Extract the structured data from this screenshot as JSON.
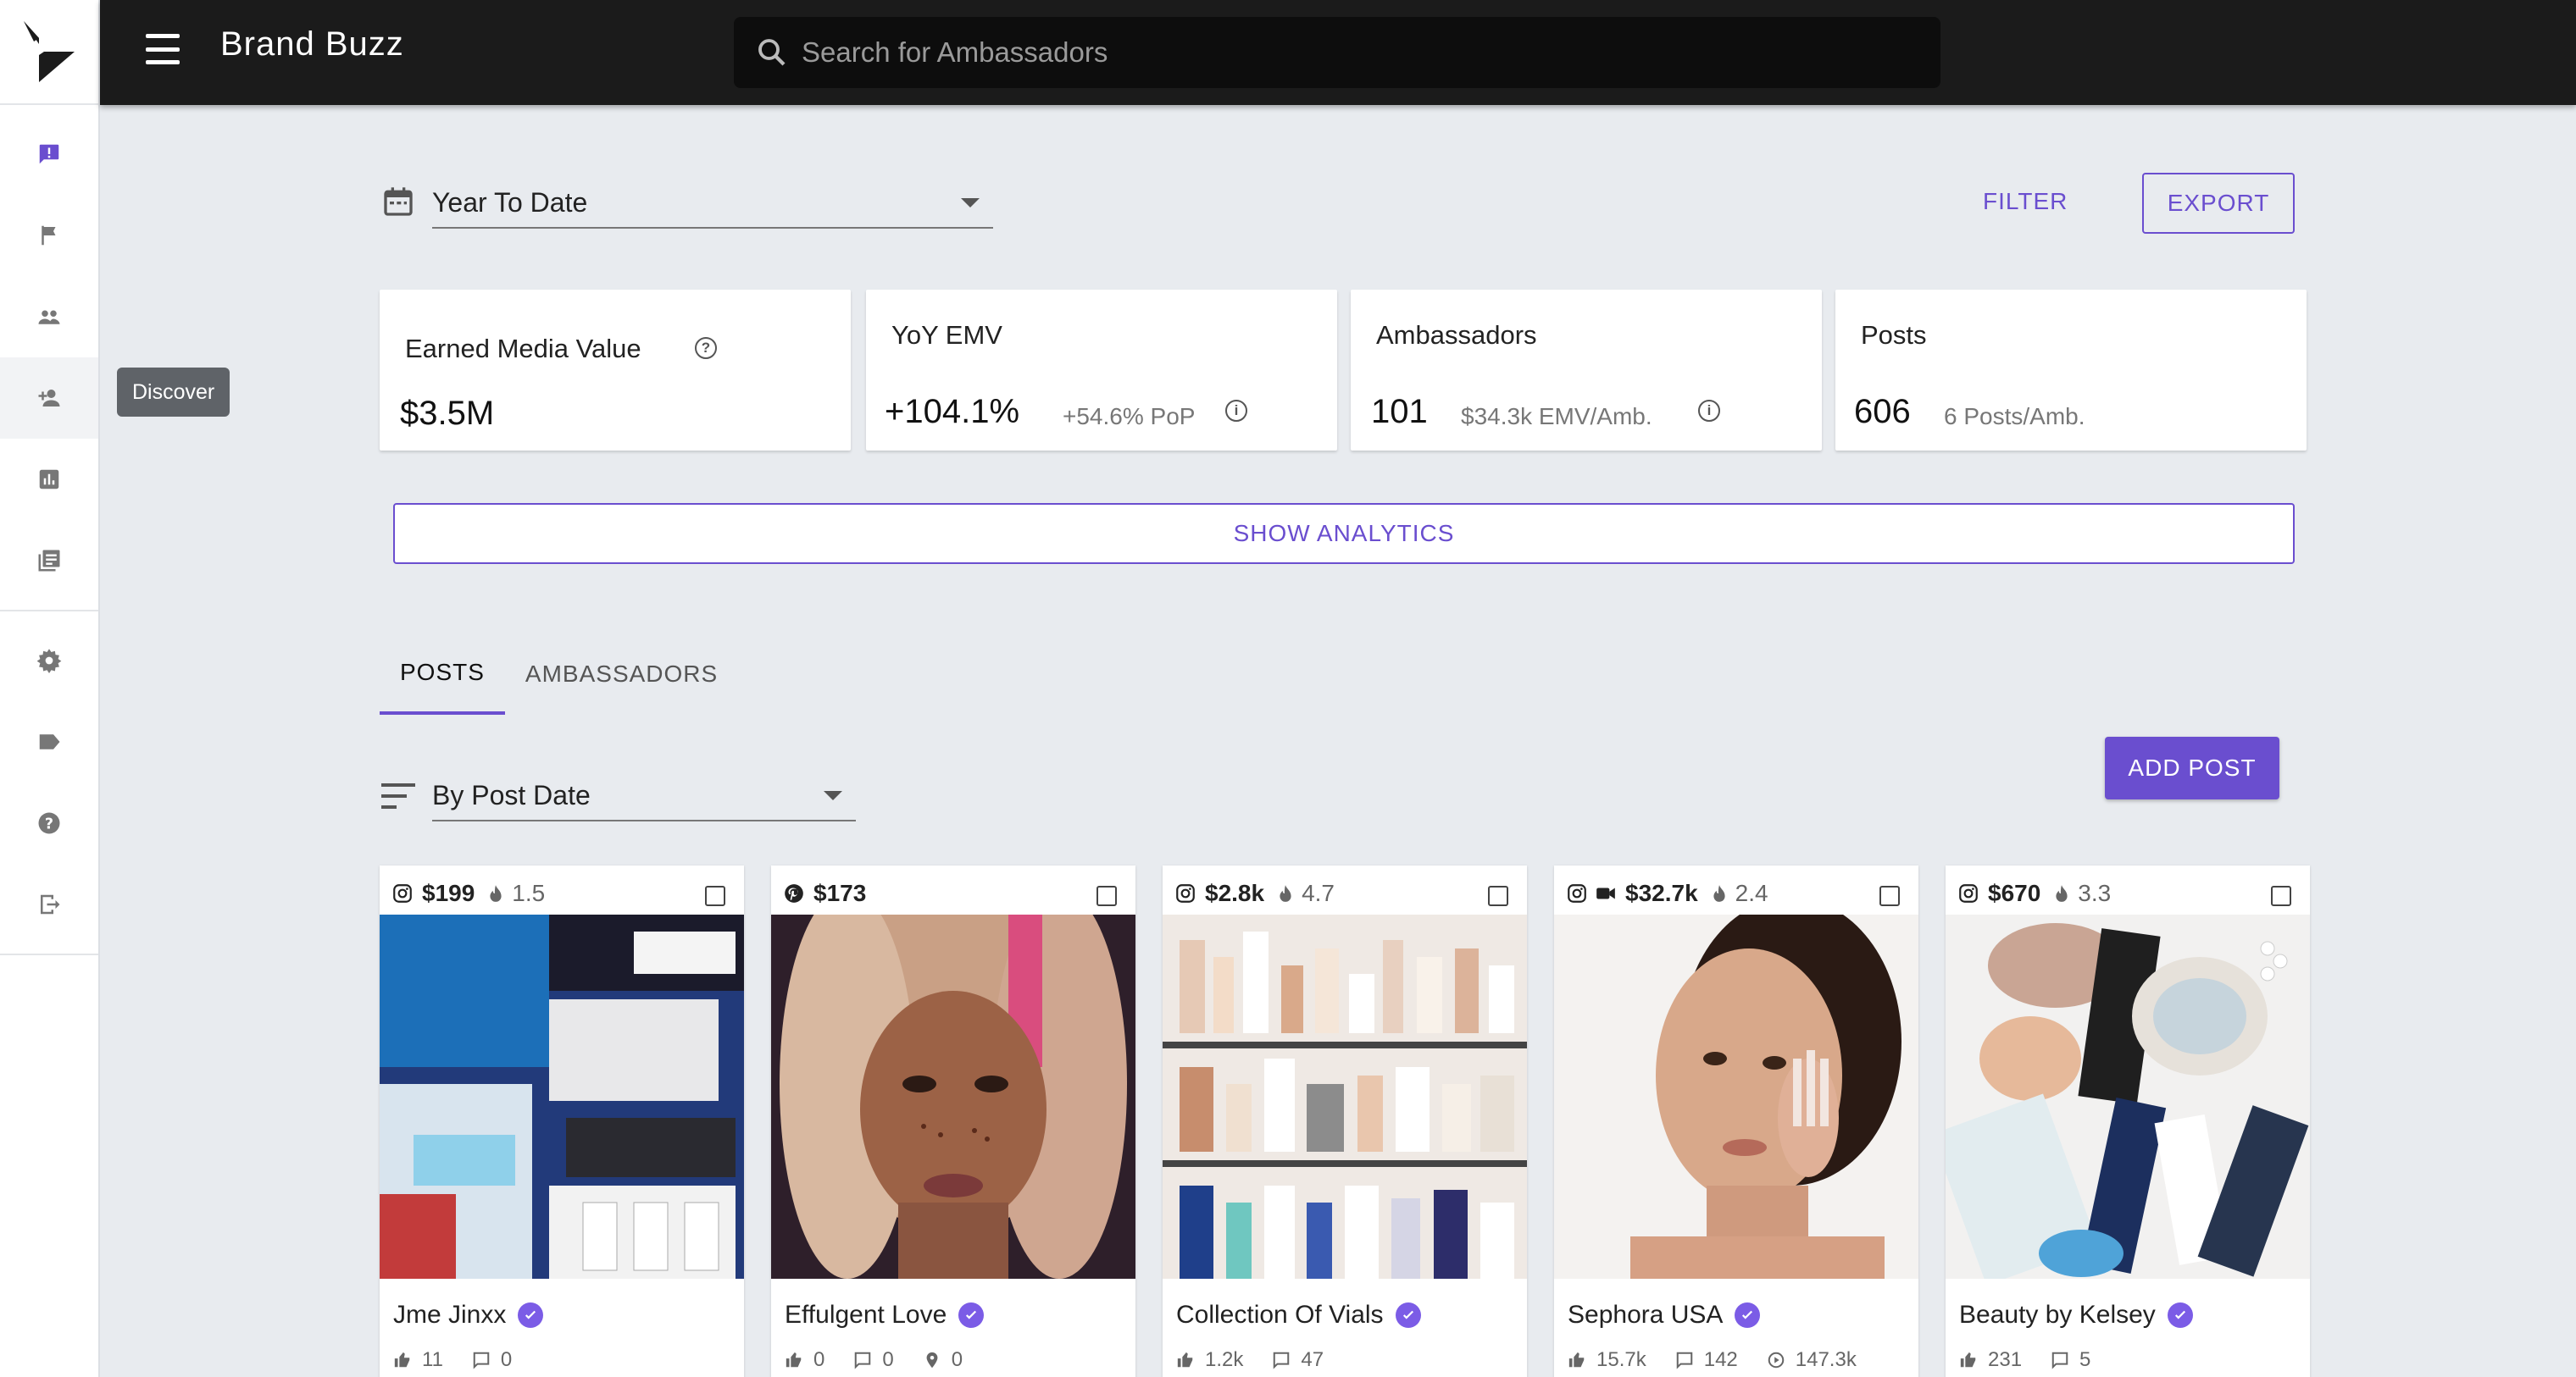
{
  "app": {
    "title": "Brand Buzz"
  },
  "search": {
    "placeholder": "Search for Ambassadors"
  },
  "sidebar": {
    "tooltip": "Discover",
    "items": [
      {
        "icon": "feedback-icon"
      },
      {
        "icon": "flag-icon"
      },
      {
        "icon": "people-icon"
      },
      {
        "icon": "person-add-icon"
      },
      {
        "icon": "analytics-icon"
      },
      {
        "icon": "library-icon"
      },
      {
        "icon": "gear-icon"
      },
      {
        "icon": "tag-icon"
      },
      {
        "icon": "help-icon"
      },
      {
        "icon": "logout-icon"
      }
    ]
  },
  "filters": {
    "date_range": "Year To Date",
    "filter_label": "FILTER",
    "export_label": "EXPORT"
  },
  "kpis": [
    {
      "label": "Earned Media Value",
      "value": "$3.5M",
      "sub": ""
    },
    {
      "label": "YoY EMV",
      "value": "+104.1%",
      "sub": "+54.6% PoP"
    },
    {
      "label": "Ambassadors",
      "value": "101",
      "sub": "$34.3k EMV/Amb."
    },
    {
      "label": "Posts",
      "value": "606",
      "sub": "6 Posts/Amb."
    }
  ],
  "analytics": {
    "label": "SHOW ANALYTICS"
  },
  "tabs": [
    {
      "label": "POSTS",
      "active": true
    },
    {
      "label": "AMBASSADORS",
      "active": false
    }
  ],
  "sort": {
    "value": "By Post Date"
  },
  "add_post": {
    "label": "ADD POST"
  },
  "accent_color": "#6a4ecf",
  "posts": [
    {
      "platform": "instagram",
      "emv": "$199",
      "score": "1.5",
      "name": "Jme Jinxx",
      "likes": "11",
      "comments": "0"
    },
    {
      "platform": "pinterest",
      "emv": "$173",
      "score": "",
      "name": "Effulgent Love",
      "likes": "0",
      "comments": "0",
      "pins": "0"
    },
    {
      "platform": "instagram",
      "emv": "$2.8k",
      "score": "4.7",
      "name": "Collection Of Vials",
      "likes": "1.2k",
      "comments": "47"
    },
    {
      "platform": "instagram-video",
      "emv": "$32.7k",
      "score": "2.4",
      "name": "Sephora USA",
      "likes": "15.7k",
      "comments": "142",
      "views": "147.3k"
    },
    {
      "platform": "instagram",
      "emv": "$670",
      "score": "3.3",
      "name": "Beauty by Kelsey",
      "likes": "231",
      "comments": "5"
    }
  ]
}
